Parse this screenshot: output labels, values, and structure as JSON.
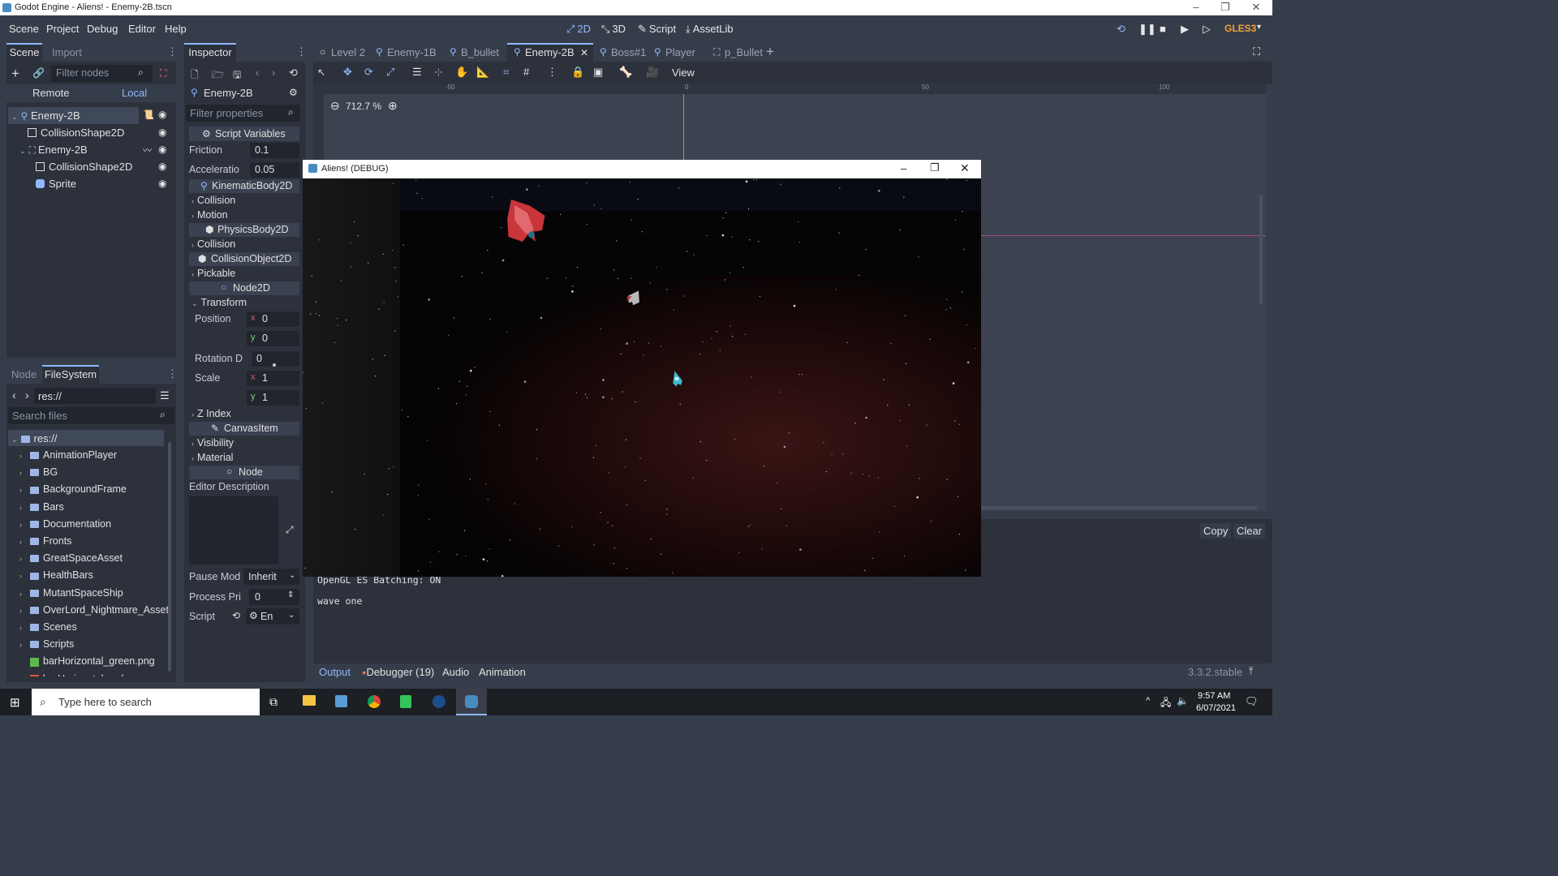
{
  "window": {
    "title": "Godot Engine - Aliens! - Enemy-2B.tscn",
    "minimize": "–",
    "maximize": "❐",
    "close": "✕"
  },
  "menubar": {
    "items": [
      "Scene",
      "Project",
      "Debug",
      "Editor",
      "Help"
    ],
    "modes": [
      {
        "label": "2D",
        "glyph": "⤢",
        "active": true
      },
      {
        "label": "3D",
        "glyph": "⤡",
        "active": false
      },
      {
        "label": "Script",
        "glyph": "✎",
        "active": false
      },
      {
        "label": "AssetLib",
        "glyph": "⤓",
        "active": false
      }
    ],
    "renderer": "GLES3"
  },
  "scene_dock": {
    "tabs": [
      "Scene",
      "Import"
    ],
    "filter_placeholder": "Filter nodes",
    "remote": "Remote",
    "local": "Local",
    "tree": [
      {
        "label": "Enemy-2B",
        "indent": 0,
        "selected": true,
        "icon": "kinematic-body-icon"
      },
      {
        "label": "CollisionShape2D",
        "indent": 1,
        "selected": false,
        "icon": "collision-shape-icon"
      },
      {
        "label": "Enemy-2B",
        "indent": 1,
        "selected": false,
        "icon": "instance-icon"
      },
      {
        "label": "CollisionShape2D",
        "indent": 2,
        "selected": false,
        "icon": "collision-shape-icon"
      },
      {
        "label": "Sprite",
        "indent": 2,
        "selected": false,
        "icon": "sprite-icon"
      }
    ]
  },
  "filesystem_dock": {
    "tabs": [
      "Node",
      "FileSystem"
    ],
    "path": "res://",
    "search_placeholder": "Search files",
    "root": "res://",
    "items": [
      {
        "label": "AnimationPlayer",
        "type": "folder"
      },
      {
        "label": "BG",
        "type": "folder"
      },
      {
        "label": "BackgroundFrame",
        "type": "folder"
      },
      {
        "label": "Bars",
        "type": "folder"
      },
      {
        "label": "Documentation",
        "type": "folder"
      },
      {
        "label": "Fronts",
        "type": "folder"
      },
      {
        "label": "GreatSpaceAsset",
        "type": "folder"
      },
      {
        "label": "HealthBars",
        "type": "folder"
      },
      {
        "label": "MutantSpaceShip",
        "type": "folder"
      },
      {
        "label": "OverLord_Nightmare_Asset",
        "type": "folder"
      },
      {
        "label": "Scenes",
        "type": "folder"
      },
      {
        "label": "Scripts",
        "type": "folder"
      },
      {
        "label": "barHorizontal_green.png",
        "type": "image-green"
      },
      {
        "label": "barHorizontal_red.png",
        "type": "image-red"
      }
    ]
  },
  "inspector": {
    "tab": "Inspector",
    "node_name": "Enemy-2B",
    "filter_placeholder": "Filter properties",
    "script_variables": "Script Variables",
    "friction_label": "Friction",
    "friction_value": "0.1",
    "accel_label": "Acceleratio",
    "accel_value": "0.05",
    "kinematic": "KinematicBody2D",
    "collision1": "Collision",
    "motion": "Motion",
    "physics": "PhysicsBody2D",
    "collision2": "Collision",
    "collision_object": "CollisionObject2D",
    "pickable": "Pickable",
    "node2d": "Node2D",
    "transform": "Transform",
    "position_label": "Position",
    "pos_x_axis": "x",
    "pos_x": "0",
    "pos_y_axis": "y",
    "pos_y": "0",
    "rotation_label": "Rotation D",
    "rotation_value": "0",
    "scale_label": "Scale",
    "scale_x_axis": "x",
    "scale_x": "1",
    "scale_y_axis": "y",
    "scale_y": "1",
    "zindex": "Z Index",
    "canvas_item": "CanvasItem",
    "visibility": "Visibility",
    "material": "Material",
    "node": "Node",
    "editor_description": "Editor Description",
    "pause_label": "Pause Mod",
    "pause_value": "Inherit",
    "process_label": "Process Pri",
    "process_value": "0",
    "script_label": "Script",
    "script_value": "En"
  },
  "scene_tabs": [
    {
      "label": "Level 2",
      "active": false
    },
    {
      "label": "Enemy-1B",
      "active": false
    },
    {
      "label": "B_bullet",
      "active": false
    },
    {
      "label": "Enemy-2B",
      "active": true
    },
    {
      "label": "Boss#1",
      "active": false
    },
    {
      "label": "Player",
      "active": false
    },
    {
      "label": "p_Bullet",
      "active": false
    }
  ],
  "viewport": {
    "view_menu": "View",
    "zoom": "712.7 %",
    "ruler_labels": [
      "-50",
      "0",
      "50",
      "100"
    ]
  },
  "game_window": {
    "title": "Aliens! (DEBUG)"
  },
  "bottom_panel": {
    "copy": "Copy",
    "clear": "Clear",
    "lines": [
      "OpenGL ES Batching: ON",
      "wave one"
    ],
    "tabs": [
      "Output",
      "Debugger (19)",
      "Audio",
      "Animation"
    ],
    "version": "3.3.2.stable"
  },
  "taskbar": {
    "search_placeholder": "Type here to search",
    "time": "9:57 AM",
    "date": "6/07/2021"
  },
  "colors": {
    "accent": "#8fb8ff",
    "panel": "#2c313c",
    "background": "#363d4a",
    "field": "#21262e",
    "selected": "#404959"
  }
}
